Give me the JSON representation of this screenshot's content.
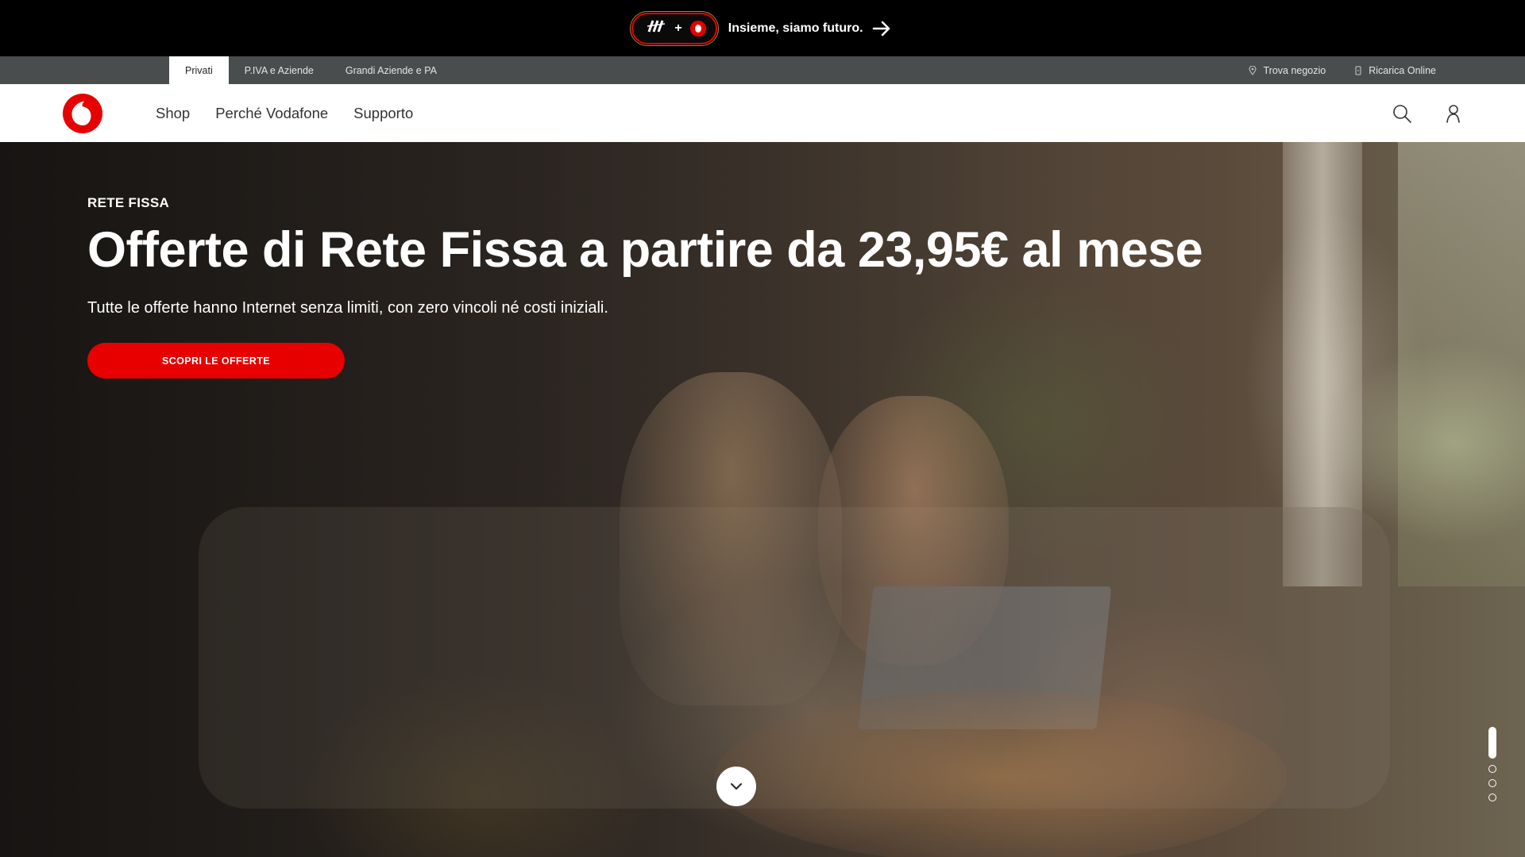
{
  "promo": {
    "text": "Insieme, siamo futuro.",
    "partner_icon": "partner-logo-icon",
    "plus": "+",
    "accent": "#e60000"
  },
  "segments": {
    "items": [
      {
        "label": "Privati",
        "active": true
      },
      {
        "label": "P.IVA e Aziende",
        "active": false
      },
      {
        "label": "Grandi Aziende e PA",
        "active": false
      }
    ],
    "utilities": [
      {
        "label": "Trova negozio",
        "icon": "location-pin-icon"
      },
      {
        "label": "Ricarica Online",
        "icon": "phone-topup-icon"
      }
    ]
  },
  "header": {
    "logo": "vodafone-logo",
    "nav": [
      "Shop",
      "Perché Vodafone",
      "Supporto"
    ],
    "icons": [
      "search-icon",
      "user-icon"
    ]
  },
  "hero": {
    "eyebrow": "RETE FISSA",
    "headline": "Offerte di Rete Fissa a partire da 23,95€ al mese",
    "subline": "Tutte le offerte hanno Internet senza limiti, con zero vincoli né costi iniziali.",
    "cta": "SCOPRI LE OFFERTE",
    "cta_color": "#e60000",
    "carousel": {
      "total_slides": 4,
      "active_slide": 1
    }
  }
}
